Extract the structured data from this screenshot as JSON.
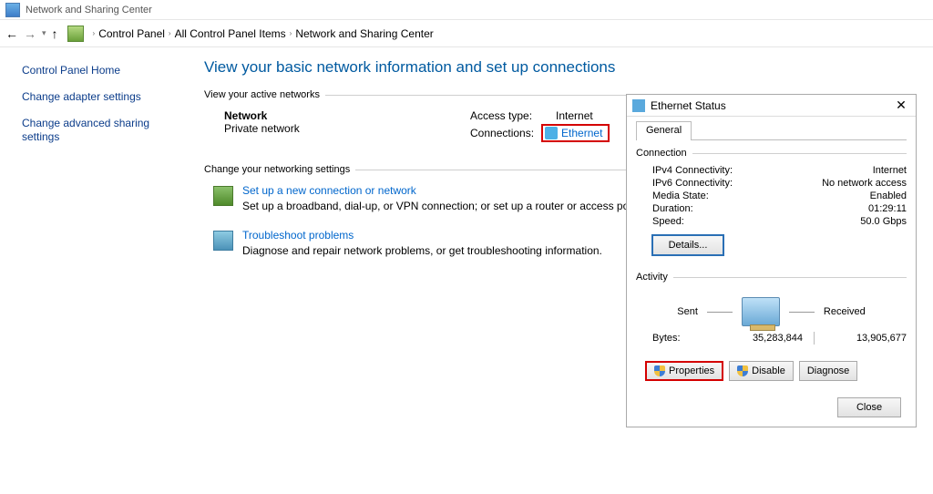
{
  "window": {
    "title": "Network and Sharing Center"
  },
  "breadcrumb": {
    "items": [
      "Control Panel",
      "All Control Panel Items",
      "Network and Sharing Center"
    ]
  },
  "sidebar": {
    "home": "Control Panel Home",
    "adapter": "Change adapter settings",
    "advanced": "Change advanced sharing settings"
  },
  "page": {
    "title": "View your basic network information and set up connections",
    "section_active": "View your active networks",
    "section_changes": "Change your networking settings"
  },
  "active_network": {
    "name": "Network",
    "type": "Private network",
    "access_label": "Access type:",
    "access_value": "Internet",
    "conn_label": "Connections:",
    "conn_value": "Ethernet"
  },
  "actions": {
    "setup_title": "Set up a new connection or network",
    "setup_desc": "Set up a broadband, dial-up, or VPN connection; or set up a router or access point.",
    "trouble_title": "Troubleshoot problems",
    "trouble_desc": "Diagnose and repair network problems, or get troubleshooting information."
  },
  "dialog": {
    "title": "Ethernet Status",
    "tab_general": "General",
    "grp_connection": "Connection",
    "ipv4_label": "IPv4 Connectivity:",
    "ipv4_value": "Internet",
    "ipv6_label": "IPv6 Connectivity:",
    "ipv6_value": "No network access",
    "media_label": "Media State:",
    "media_value": "Enabled",
    "duration_label": "Duration:",
    "duration_value": "01:29:11",
    "speed_label": "Speed:",
    "speed_value": "50.0 Gbps",
    "details_btn": "Details...",
    "grp_activity": "Activity",
    "sent_label": "Sent",
    "received_label": "Received",
    "bytes_label": "Bytes:",
    "bytes_sent": "35,283,844",
    "bytes_recv": "13,905,677",
    "btn_properties": "Properties",
    "btn_disable": "Disable",
    "btn_diagnose": "Diagnose",
    "btn_close": "Close"
  }
}
